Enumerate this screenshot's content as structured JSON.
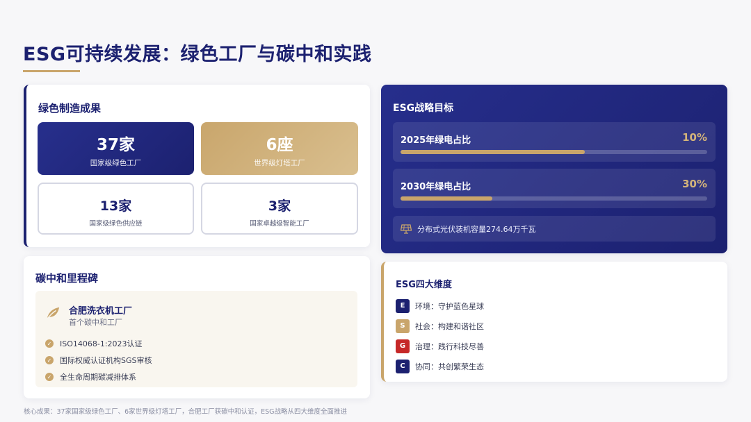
{
  "page": {
    "title": "ESG可持续发展：绿色工厂与碳中和实践",
    "footnote": "核心成果：37家国家级绿色工厂、6家世界级灯塔工厂，合肥工厂获碳中和认证，ESG战略从四大维度全面推进"
  },
  "green_manufacturing": {
    "title": "绿色制造成果",
    "stats": [
      {
        "value": "37家",
        "label": "国家级绿色工厂"
      },
      {
        "value": "6座",
        "label": "世界级灯塔工厂"
      },
      {
        "value": "13家",
        "label": "国家级绿色供应链"
      },
      {
        "value": "3家",
        "label": "国家卓越级智能工厂"
      }
    ]
  },
  "carbon_milestone": {
    "title": "碳中和里程碑",
    "factory_name": "合肥洗衣机工厂",
    "factory_subtitle": "首个碳中和工厂",
    "icon": "leaf-icon",
    "items": [
      "ISO14068-1:2023认证",
      "国际权威认证机构SGS审核",
      "全生命周期碳减排体系"
    ]
  },
  "esg_goals": {
    "title": "ESG战略目标",
    "goals": [
      {
        "label": "2025年绿电占比",
        "value": "10%",
        "progress": 0.6
      },
      {
        "label": "2030年绿电占比",
        "value": "30%",
        "progress": 0.3
      }
    ],
    "solar": {
      "icon": "solar-panel-icon",
      "text": "分布式光伏装机容量274.64万千瓦"
    }
  },
  "esg_dimensions": {
    "title": "ESG四大维度",
    "items": [
      {
        "badge": "E",
        "text": "环境：守护蓝色星球",
        "color": "#1c2170"
      },
      {
        "badge": "S",
        "text": "社会：构建和谐社区",
        "color": "#c9a56b"
      },
      {
        "badge": "G",
        "text": "治理：践行科技尽善",
        "color": "#c62828"
      },
      {
        "badge": "C",
        "text": "协同：共创繁荣生态",
        "color": "#1c2170"
      }
    ]
  },
  "colors": {
    "navy": "#1c2170",
    "gold": "#c9a56b",
    "red": "#c62828"
  }
}
